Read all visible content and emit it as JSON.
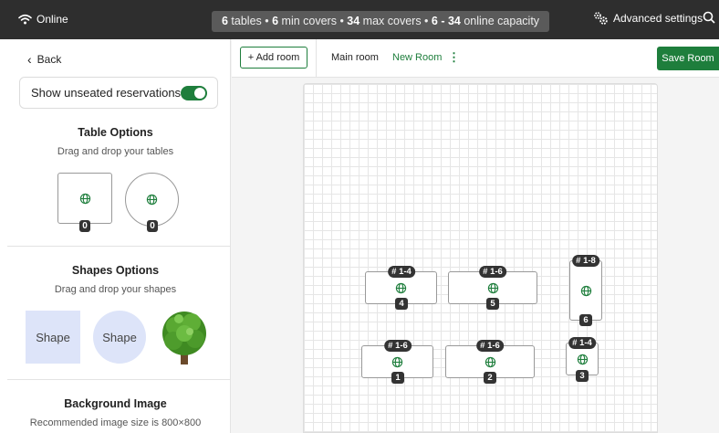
{
  "topbar": {
    "status": "Online",
    "summary": [
      {
        "value": "6",
        "label": " tables • "
      },
      {
        "value": "6",
        "label": " min covers • "
      },
      {
        "value": "34",
        "label": " max covers • "
      },
      {
        "value": "6 - 34",
        "label": " online capacity"
      }
    ],
    "advanced_label": "Advanced settings",
    "icons": [
      "wifi-icon",
      "settings-icon",
      "search-icon"
    ]
  },
  "left_panel": {
    "back_label": "Back",
    "unseated_label": "Show unseated reservations",
    "unseated_enabled": true,
    "table_options": {
      "title": "Table Options",
      "subtitle": "Drag and drop your tables",
      "items": [
        {
          "shape": "square",
          "count": "0"
        },
        {
          "shape": "round",
          "count": "0"
        }
      ]
    },
    "shapes_options": {
      "title": "Shapes Options",
      "subtitle": "Drag and drop your shapes",
      "square_label": "Shape",
      "round_label": "Shape"
    },
    "background": {
      "title": "Background Image",
      "subtitle": "Recommended image size is 800×800"
    }
  },
  "toolbar": {
    "add_room_label": "+ Add room",
    "rooms": [
      "Main room",
      "New Room"
    ],
    "active_room": "New Room",
    "save_label": "Save Room"
  },
  "floor_tables": [
    {
      "capacity": "# 1-4",
      "number": "4"
    },
    {
      "capacity": "# 1-6",
      "number": "5"
    },
    {
      "capacity": "# 1-8",
      "number": "6"
    },
    {
      "capacity": "# 1-6",
      "number": "1"
    },
    {
      "capacity": "# 1-6",
      "number": "2"
    },
    {
      "capacity": "# 1-4",
      "number": "3"
    }
  ],
  "colors": {
    "accent": "#1e7e3c",
    "topbar": "#2e2e2e",
    "shape_fill": "#dde4f9"
  }
}
